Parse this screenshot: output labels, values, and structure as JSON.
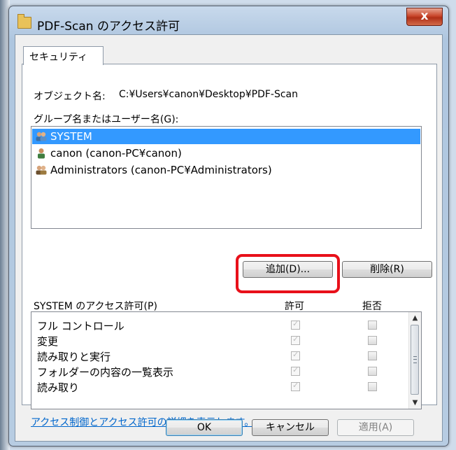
{
  "window": {
    "title": "PDF-Scan のアクセス許可",
    "close_glyph": "x"
  },
  "tabs": [
    {
      "label": "セキュリティ"
    }
  ],
  "object": {
    "label": "オブジェクト名:",
    "value": "C:¥Users¥canon¥Desktop¥PDF-Scan"
  },
  "groups": {
    "label": "グループ名またはユーザー名(G):",
    "items": [
      {
        "name": "SYSTEM",
        "icon": "users-group-icon",
        "selected": true
      },
      {
        "name": "canon (canon-PC¥canon)",
        "icon": "user-icon",
        "selected": false
      },
      {
        "name": "Administrators (canon-PC¥Administrators)",
        "icon": "users-group-icon",
        "selected": false
      }
    ]
  },
  "buttons": {
    "add": "追加(D)...",
    "remove": "削除(R)",
    "ok": "OK",
    "cancel": "キャンセル",
    "apply": "適用(A)"
  },
  "permissions": {
    "label": "SYSTEM のアクセス許可(P)",
    "allow_header": "許可",
    "deny_header": "拒否",
    "items": [
      {
        "name": "フル コントロール",
        "allow": true,
        "deny": false
      },
      {
        "name": "変更",
        "allow": true,
        "deny": false
      },
      {
        "name": "読み取りと実行",
        "allow": true,
        "deny": false
      },
      {
        "name": "フォルダーの内容の一覧表示",
        "allow": true,
        "deny": false
      },
      {
        "name": "読み取り",
        "allow": true,
        "deny": false
      }
    ]
  },
  "link": "アクセス制御とアクセス許可の詳細を表示します。",
  "colors": {
    "selection": "#3399ff",
    "highlight_box": "#e8101a",
    "link": "#0066cc"
  }
}
